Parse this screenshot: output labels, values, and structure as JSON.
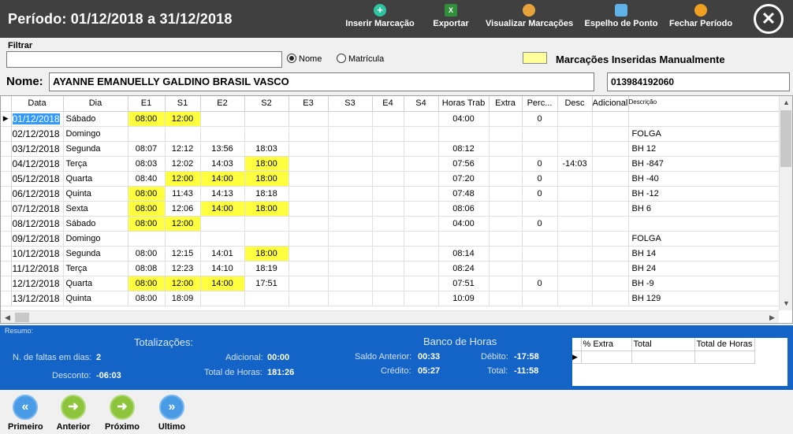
{
  "header": {
    "period": "Período: 01/12/2018  a  31/12/2018",
    "buttons": [
      {
        "label": "Inserir Marcação",
        "icon": "plus-circle-icon",
        "color": "#2ec4a0"
      },
      {
        "label": "Exportar",
        "icon": "excel-icon",
        "color": "#2f8f3a"
      },
      {
        "label": "Visualizar Marcações",
        "icon": "view-marks-icon",
        "color": "#e8a23a"
      },
      {
        "label": "Espelho de Ponto",
        "icon": "mirror-icon",
        "color": "#5fb3e8"
      },
      {
        "label": "Fechar Período",
        "icon": "lightbulb-icon",
        "color": "#f0a020"
      }
    ],
    "close_icon": "close-icon"
  },
  "filter": {
    "label": "Filtrar",
    "value": "",
    "radio_name": "Nome",
    "radio_matricula": "Matrícula",
    "selected": "Nome",
    "legend_label": "Marcações Inseridas Manualmente",
    "legend_color": "#ffff99"
  },
  "employee": {
    "name_label": "Nome:",
    "name": "AYANNE EMANUELLY GALDINO BRASIL VASCO",
    "code": "013984192060"
  },
  "grid": {
    "columns": [
      "Data",
      "Dia",
      "E1",
      "S1",
      "E2",
      "S2",
      "E3",
      "S3",
      "E4",
      "S4",
      "Horas Trab",
      "Extra",
      "Perc...",
      "Desc",
      "Adicional",
      "Descrição"
    ],
    "highlight_color": "#ffff40",
    "rows": [
      {
        "date": "01/12/2018",
        "day": "Sábado",
        "e1": "08:00",
        "s1": "12:00",
        "e2": "",
        "s2": "",
        "horas": "04:00",
        "extra": "",
        "perc": "0",
        "desc": "",
        "adic": "",
        "dsc": "",
        "hl": [
          "e1",
          "s1"
        ],
        "selected": true
      },
      {
        "date": "02/12/2018",
        "day": "Domingo",
        "e1": "",
        "s1": "",
        "e2": "",
        "s2": "",
        "horas": "",
        "extra": "",
        "perc": "",
        "desc": "",
        "adic": "",
        "dsc": "FOLGA",
        "hl": []
      },
      {
        "date": "03/12/2018",
        "day": "Segunda",
        "e1": "08:07",
        "s1": "12:12",
        "e2": "13:56",
        "s2": "18:03",
        "horas": "08:12",
        "extra": "",
        "perc": "",
        "desc": "",
        "adic": "",
        "dsc": "BH 12",
        "hl": []
      },
      {
        "date": "04/12/2018",
        "day": "Terça",
        "e1": "08:03",
        "s1": "12:02",
        "e2": "14:03",
        "s2": "18:00",
        "horas": "07:56",
        "extra": "",
        "perc": "0",
        "desc": "-14:03",
        "adic": "",
        "dsc": "BH -847",
        "hl": [
          "s2"
        ]
      },
      {
        "date": "05/12/2018",
        "day": "Quarta",
        "e1": "08:40",
        "s1": "12:00",
        "e2": "14:00",
        "s2": "18:00",
        "horas": "07:20",
        "extra": "",
        "perc": "0",
        "desc": "",
        "adic": "",
        "dsc": "BH -40",
        "hl": [
          "s1",
          "e2",
          "s2"
        ]
      },
      {
        "date": "06/12/2018",
        "day": "Quinta",
        "e1": "08:00",
        "s1": "11:43",
        "e2": "14:13",
        "s2": "18:18",
        "horas": "07:48",
        "extra": "",
        "perc": "0",
        "desc": "",
        "adic": "",
        "dsc": "BH -12",
        "hl": [
          "e1"
        ]
      },
      {
        "date": "07/12/2018",
        "day": "Sexta",
        "e1": "08:00",
        "s1": "12:06",
        "e2": "14:00",
        "s2": "18:00",
        "horas": "08:06",
        "extra": "",
        "perc": "",
        "desc": "",
        "adic": "",
        "dsc": "BH 6",
        "hl": [
          "e1",
          "e2",
          "s2"
        ]
      },
      {
        "date": "08/12/2018",
        "day": "Sábado",
        "e1": "08:00",
        "s1": "12:00",
        "e2": "",
        "s2": "",
        "horas": "04:00",
        "extra": "",
        "perc": "0",
        "desc": "",
        "adic": "",
        "dsc": "",
        "hl": [
          "e1",
          "s1"
        ]
      },
      {
        "date": "09/12/2018",
        "day": "Domingo",
        "e1": "",
        "s1": "",
        "e2": "",
        "s2": "",
        "horas": "",
        "extra": "",
        "perc": "",
        "desc": "",
        "adic": "",
        "dsc": "FOLGA",
        "hl": []
      },
      {
        "date": "10/12/2018",
        "day": "Segunda",
        "e1": "08:00",
        "s1": "12:15",
        "e2": "14:01",
        "s2": "18:00",
        "horas": "08:14",
        "extra": "",
        "perc": "",
        "desc": "",
        "adic": "",
        "dsc": "BH 14",
        "hl": [
          "s2"
        ]
      },
      {
        "date": "11/12/2018",
        "day": "Terça",
        "e1": "08:08",
        "s1": "12:23",
        "e2": "14:10",
        "s2": "18:19",
        "horas": "08:24",
        "extra": "",
        "perc": "",
        "desc": "",
        "adic": "",
        "dsc": "BH 24",
        "hl": []
      },
      {
        "date": "12/12/2018",
        "day": "Quarta",
        "e1": "08:00",
        "s1": "12:00",
        "e2": "14:00",
        "s2": "17:51",
        "horas": "07:51",
        "extra": "",
        "perc": "0",
        "desc": "",
        "adic": "",
        "dsc": "BH -9",
        "hl": [
          "e1",
          "s1",
          "e2"
        ]
      },
      {
        "date": "13/12/2018",
        "day": "Quinta",
        "e1": "08:00",
        "s1": "18:09",
        "e2": "",
        "s2": "",
        "horas": "10:09",
        "extra": "",
        "perc": "",
        "desc": "",
        "adic": "",
        "dsc": "BH 129",
        "hl": []
      }
    ]
  },
  "summary": {
    "resumo": "Resumo:",
    "totalizacoes": "Totalizações:",
    "banco_horas": "Banco de Horas",
    "faltas_label": "N. de faltas em dias:",
    "faltas_value": "2",
    "desconto_label": "Desconto:",
    "desconto_value": "-06:03",
    "adicional_label": "Adicional:",
    "adicional_value": "00:00",
    "total_horas_label": "Total de Horas:",
    "total_horas_value": "181:26",
    "saldo_label": "Saldo Anterior:",
    "saldo_value": "00:33",
    "credito_label": "Crédito:",
    "credito_value": "05:27",
    "debito_label": "Débito:",
    "debito_value": "-17:58",
    "total_label": "Total:",
    "total_value": "-11:58",
    "mini_columns": [
      "% Extra",
      "Total",
      "Total de Horas"
    ],
    "background_color": "#1464c8"
  },
  "footer": {
    "buttons": [
      {
        "label": "Primeiro",
        "icon": "double-chevron-left-icon",
        "glyph": "«",
        "color": "blue"
      },
      {
        "label": "Anterior",
        "icon": "arrow-right-icon",
        "glyph": "➜",
        "color": "green"
      },
      {
        "label": "Próximo",
        "icon": "arrow-right-icon",
        "glyph": "➜",
        "color": "green"
      },
      {
        "label": "Ultimo",
        "icon": "double-chevron-right-icon",
        "glyph": "»",
        "color": "blue"
      }
    ]
  }
}
